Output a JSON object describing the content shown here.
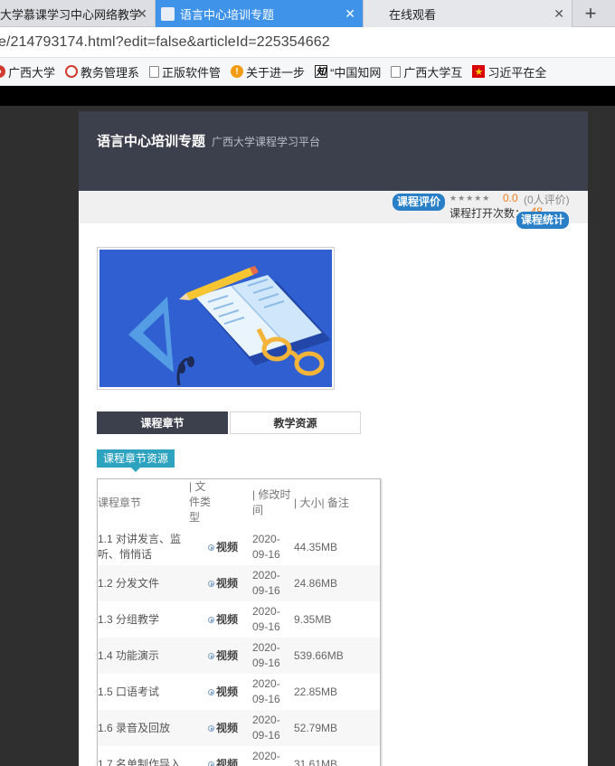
{
  "browser": {
    "tabs": [
      {
        "label": "大学慕课学习中心网络教学"
      },
      {
        "label": "语言中心培训专题"
      },
      {
        "label": "在线观看"
      }
    ],
    "close_glyph": "✕",
    "new_tab_glyph": "+",
    "url": "e/214793174.html?edit=false&articleId=225354662",
    "bookmarks": [
      {
        "label": "广西大学",
        "icon": "red-circle-icon"
      },
      {
        "label": "教务管理系",
        "icon": "seal-icon"
      },
      {
        "label": "正版软件管",
        "icon": "document-icon"
      },
      {
        "label": "关于进一步",
        "icon": "flame-icon"
      },
      {
        "label": "“中国知网",
        "icon": "zhi-icon"
      },
      {
        "label": "广西大学互",
        "icon": "document-icon"
      },
      {
        "label": "习近平在全",
        "icon": "party-emblem-icon"
      }
    ]
  },
  "course": {
    "title": "语言中心培训专题",
    "subtitle": "广西大学课程学习平台",
    "evaluate_badge": "课程评价",
    "rating_score": "0.0",
    "rating_count": "(0人评价)",
    "open_count_label": "课程打开次数：",
    "open_count_value": "48",
    "stats_badge": "课程统计"
  },
  "content_tabs": [
    {
      "label": "课程章节",
      "active": true
    },
    {
      "label": "教学资源",
      "active": false
    }
  ],
  "resource_label": "课程章节资源",
  "table": {
    "headers": {
      "chapter": "课程章节",
      "type": "| 文件类型",
      "modified": "| 修改时间",
      "size_note": "| 大小| 备注"
    },
    "rows": [
      {
        "chapter": "1.1 对讲发言、监听、悄悄话",
        "type": "视频",
        "date": "2020-09-16",
        "size": "44.35MB"
      },
      {
        "chapter": "1.2 分发文件",
        "type": "视频",
        "date": "2020-09-16",
        "size": "24.86MB"
      },
      {
        "chapter": "1.3 分组教学",
        "type": "视频",
        "date": "2020-09-16",
        "size": "9.35MB"
      },
      {
        "chapter": "1.4 功能演示",
        "type": "视频",
        "date": "2020-09-16",
        "size": "539.66MB"
      },
      {
        "chapter": "1.5 口语考试",
        "type": "视频",
        "date": "2020-09-16",
        "size": "22.85MB"
      },
      {
        "chapter": "1.6 录音及回放",
        "type": "视频",
        "date": "2020-09-16",
        "size": "52.79MB"
      },
      {
        "chapter": "1.7 名单制作导入",
        "type": "视频",
        "date": "2020-",
        "size": "31.61MB"
      }
    ]
  },
  "colors": {
    "header_dark": "#3c404d",
    "active_tab_blue": "#3f93e8",
    "badge_blue": "#2a80c7",
    "resource_teal": "#2ea3bf",
    "rating_orange": "#f07c20"
  }
}
